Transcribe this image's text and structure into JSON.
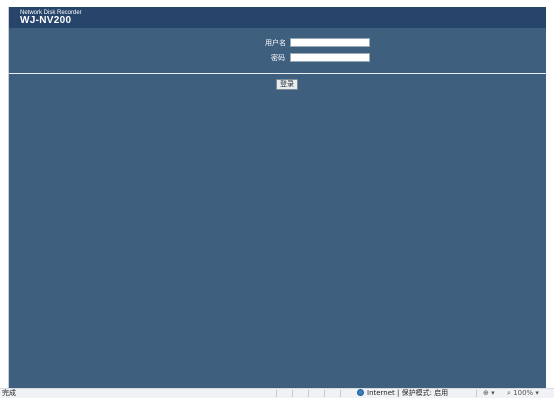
{
  "header": {
    "product_line": "Network Disk Recorder",
    "model": "WJ-NV200"
  },
  "login_form": {
    "username_label": "用户名",
    "username_value": "",
    "password_label": "密码",
    "password_value": "",
    "submit_label": "登录"
  },
  "status_bar": {
    "status": "完成",
    "zone": "Internet | 保护模式: 启用",
    "zoom": "100%"
  },
  "icons": {
    "zone": "globe-icon",
    "security": "lock-icon",
    "zoom": "magnifier-icon"
  },
  "colors": {
    "page_bg": "#3f5f7f",
    "header_bg": "#27446a"
  }
}
